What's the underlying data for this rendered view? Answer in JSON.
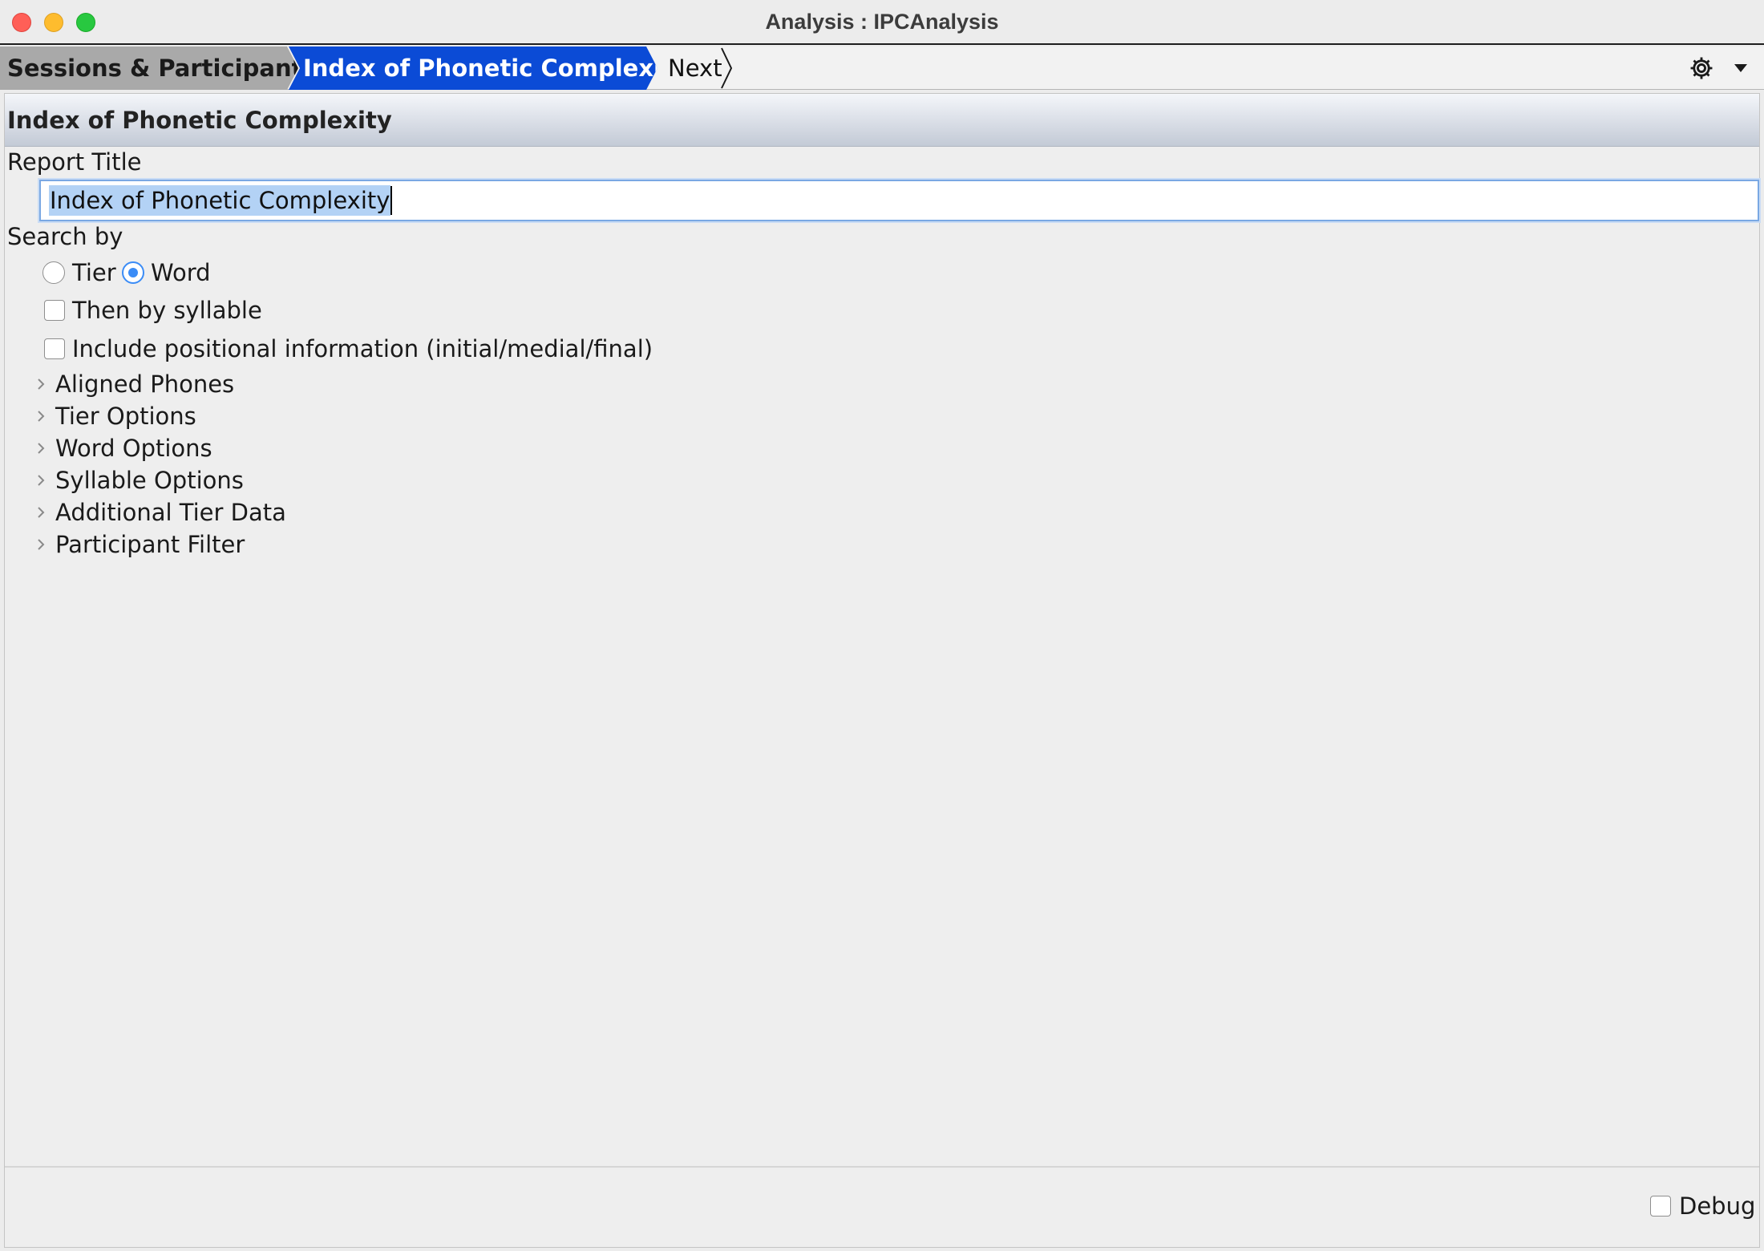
{
  "window": {
    "title": "Analysis : IPCAnalysis"
  },
  "breadcrumb": {
    "items": [
      {
        "label": "Sessions & Participants"
      },
      {
        "label": "Index of Phonetic Complexity"
      },
      {
        "label": "Next"
      }
    ],
    "settings_icon": "gear-icon",
    "dropdown_icon": "caret-down-icon"
  },
  "panel": {
    "title": "Index of Phonetic Complexity",
    "report_title_label": "Report Title",
    "report_title_value": "Index of Phonetic Complexity",
    "search_by_label": "Search by",
    "search_by_options": [
      {
        "label": "Tier",
        "selected": false
      },
      {
        "label": "Word",
        "selected": true
      }
    ],
    "then_by_syllable": {
      "label": "Then by syllable",
      "checked": false
    },
    "positional_info": {
      "label": "Include positional information (initial/medial/final)",
      "checked": false
    },
    "sections": [
      {
        "label": "Aligned Phones"
      },
      {
        "label": "Tier Options"
      },
      {
        "label": "Word Options"
      },
      {
        "label": "Syllable Options"
      },
      {
        "label": "Additional Tier Data"
      },
      {
        "label": "Participant Filter"
      }
    ],
    "debug": {
      "label": "Debug",
      "checked": false
    }
  },
  "colors": {
    "active_crumb": "#0b4bd6",
    "inactive_crumb": "#a9a9a9",
    "selection": "#b3d2f5",
    "focus": "#3b8cf6"
  }
}
